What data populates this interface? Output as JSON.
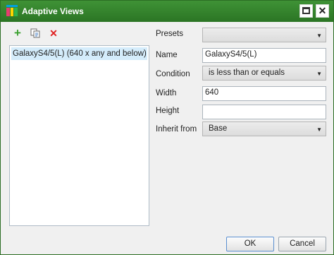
{
  "window": {
    "title": "Adaptive Views",
    "restore_glyph": "",
    "close_glyph": "✕"
  },
  "toolbar": {
    "add_glyph": "+",
    "delete_glyph": "✕"
  },
  "icons": {
    "app": "app-logo-icon",
    "add": "plus-icon",
    "duplicate": "copy-icon",
    "delete": "delete-icon"
  },
  "views_list": {
    "items": [
      {
        "label": "GalaxyS4/5(L) (640 x any and below)",
        "selected": true
      }
    ]
  },
  "form": {
    "presets": {
      "label": "Presets",
      "value": ""
    },
    "name": {
      "label": "Name",
      "value": "GalaxyS4/5(L)"
    },
    "condition": {
      "label": "Condition",
      "value": "is less than or equals"
    },
    "width": {
      "label": "Width",
      "value": "640"
    },
    "height": {
      "label": "Height",
      "value": ""
    },
    "inherit_from": {
      "label": "Inherit from",
      "value": "Base"
    },
    "dropdown_caret": "▼"
  },
  "buttons": {
    "ok": "OK",
    "cancel": "Cancel"
  },
  "colors": {
    "titlebar": "#2b7524",
    "selection": "#d4ecfb",
    "add_icon": "#3aa02f",
    "delete_icon": "#e02020"
  }
}
